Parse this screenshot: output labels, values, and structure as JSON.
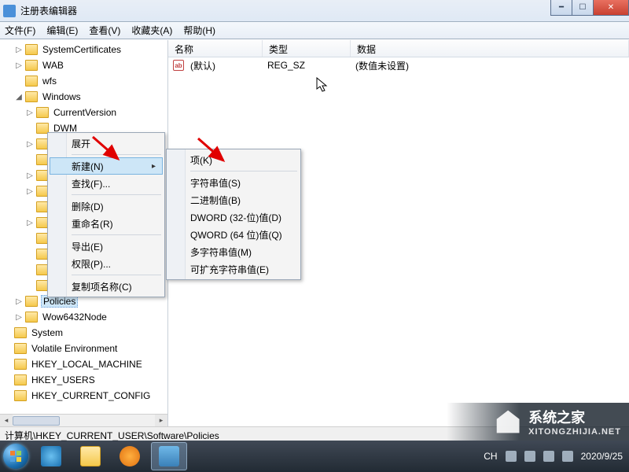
{
  "window": {
    "title": "注册表编辑器"
  },
  "menu": {
    "file": "文件(F)",
    "edit": "编辑(E)",
    "view": "查看(V)",
    "favorites": "收藏夹(A)",
    "help": "帮助(H)"
  },
  "tree": {
    "items": [
      {
        "label": "SystemCertificates",
        "indent": 1,
        "toggle": "▷"
      },
      {
        "label": "WAB",
        "indent": 1,
        "toggle": "▷"
      },
      {
        "label": "wfs",
        "indent": 1,
        "toggle": ""
      },
      {
        "label": "Windows",
        "indent": 1,
        "toggle": "◢"
      },
      {
        "label": "CurrentVersion",
        "indent": 2,
        "toggle": "▷"
      },
      {
        "label": "DWM",
        "indent": 2,
        "toggle": ""
      },
      {
        "label": "",
        "indent": 2,
        "toggle": "▷"
      },
      {
        "label": "",
        "indent": 2,
        "toggle": ""
      },
      {
        "label": "",
        "indent": 2,
        "toggle": "▷"
      },
      {
        "label": "",
        "indent": 2,
        "toggle": "▷"
      },
      {
        "label": "",
        "indent": 2,
        "toggle": ""
      },
      {
        "label": "",
        "indent": 2,
        "toggle": "▷"
      },
      {
        "label": "",
        "indent": 2,
        "toggle": ""
      },
      {
        "label": "",
        "indent": 2,
        "toggle": ""
      },
      {
        "label": "",
        "indent": 2,
        "toggle": ""
      },
      {
        "label": "",
        "indent": 2,
        "toggle": ""
      },
      {
        "label": "Policies",
        "indent": 1,
        "toggle": "▷",
        "selected": true
      },
      {
        "label": "Wow6432Node",
        "indent": 1,
        "toggle": "▷"
      },
      {
        "label": "System",
        "indent": 0,
        "toggle": ""
      },
      {
        "label": "Volatile Environment",
        "indent": 0,
        "toggle": ""
      },
      {
        "label": "HKEY_LOCAL_MACHINE",
        "indent": 0,
        "toggle": ""
      },
      {
        "label": "HKEY_USERS",
        "indent": 0,
        "toggle": ""
      },
      {
        "label": "HKEY_CURRENT_CONFIG",
        "indent": 0,
        "toggle": ""
      }
    ]
  },
  "list": {
    "cols": {
      "name": "名称",
      "type": "类型",
      "data": "数据"
    },
    "row": {
      "name": "(默认)",
      "type": "REG_SZ",
      "data": "(数值未设置)"
    }
  },
  "ctx1": {
    "expand": "展开",
    "new": "新建(N)",
    "find": "查找(F)...",
    "delete": "删除(D)",
    "rename": "重命名(R)",
    "export": "导出(E)",
    "perm": "权限(P)...",
    "copykey": "复制项名称(C)"
  },
  "ctx2": {
    "key": "项(K)",
    "string": "字符串值(S)",
    "binary": "二进制值(B)",
    "dword": "DWORD (32-位)值(D)",
    "qword": "QWORD (64 位)值(Q)",
    "multi": "多字符串值(M)",
    "expand": "可扩充字符串值(E)"
  },
  "status": {
    "path": "计算机\\HKEY_CURRENT_USER\\Software\\Policies"
  },
  "tray": {
    "ime": "CH",
    "time": "2020/9/25"
  },
  "watermark": {
    "t1": "系统之家",
    "t2": "XITONGZHIJIA.NET"
  }
}
